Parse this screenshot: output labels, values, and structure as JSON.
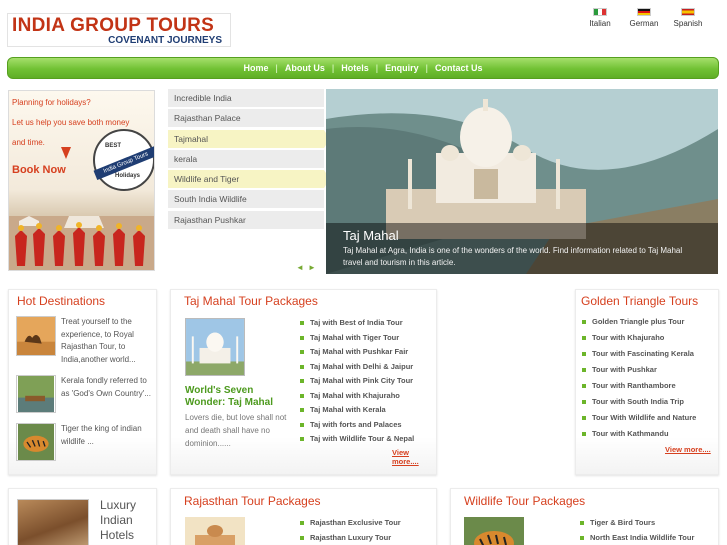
{
  "logo": {
    "title": "INDIA GROUP TOURS",
    "subtitle": "COVENANT JOURNEYS"
  },
  "languages": [
    {
      "label": "Italian",
      "icon": "flag-italy-icon"
    },
    {
      "label": "German",
      "icon": "flag-germany-icon"
    },
    {
      "label": "Spanish",
      "icon": "flag-spain-icon"
    }
  ],
  "nav": [
    "Home",
    "About Us",
    "Hotels",
    "Enquiry",
    "Contact Us"
  ],
  "promo": {
    "line1": "Planning for holidays?",
    "line2": "Let us help you save both money",
    "line3": "and time.",
    "book": "Book Now",
    "badge_best": "BEST",
    "badge_name": "India Group Tours",
    "badge_holidays": "Holidays"
  },
  "tour_list": [
    "Incredible India",
    "Rajasthan Palace",
    "Tajmahal",
    "kerala",
    "Wildlife and Tiger",
    "South India Wildlife",
    "Rajasthan Pushkar"
  ],
  "slide": {
    "title": "Taj Mahal",
    "text": "Taj Mahal at Agra, India is one of the wonders of the world. Find information related to Taj Mahal travel and tourism in this article.",
    "prev": "◄",
    "next": "►"
  },
  "hot": {
    "title": "Hot Destinations",
    "items": [
      "Treat yourself to the experience, to Royal Rajasthan Tour, to India,another world...",
      "Kerala fondly referred to as 'God's Own Country'...",
      "Tiger the king of indian wildlife ..."
    ]
  },
  "taj": {
    "title": "Taj Mahal Tour Packages",
    "heading": "World's Seven Wonder: Taj Mahal",
    "text": "Lovers die, but love shall not and death shall have no dominion......",
    "links": [
      "Taj with Best of India Tour",
      "Taj Mahal with Tiger Tour",
      "Taj Mahal with Pushkar Fair",
      "Taj Mahal with Delhi & Jaipur",
      "Taj Mahal with Pink City Tour",
      "Taj Mahal with Khajuraho",
      "Taj Mahal with Kerala",
      "Taj with forts and Palaces",
      "Taj with Wildlife Tour & Nepal"
    ],
    "more": "View more...."
  },
  "golden": {
    "title": "Golden Triangle Tours",
    "links": [
      "Golden Triangle plus Tour",
      "Tour with Khajuraho",
      "Tour with Fascinating Kerala",
      "Tour with Pushkar",
      "Tour with Ranthambore",
      "Tour with South India Trip",
      "Tour With Wildlife and Nature",
      "Tour with Kathmandu"
    ],
    "more": "View more...."
  },
  "luxury": {
    "text": "Luxury Indian Hotels"
  },
  "rajasthan": {
    "title": "Rajasthan Tour Packages",
    "links": [
      "Rajasthan Exclusive Tour",
      "Rajasthan Luxury Tour"
    ]
  },
  "wildlife": {
    "title": "Wildlife Tour Packages",
    "links": [
      "Tiger & Bird Tours",
      "North East India Wildlife Tour"
    ]
  }
}
